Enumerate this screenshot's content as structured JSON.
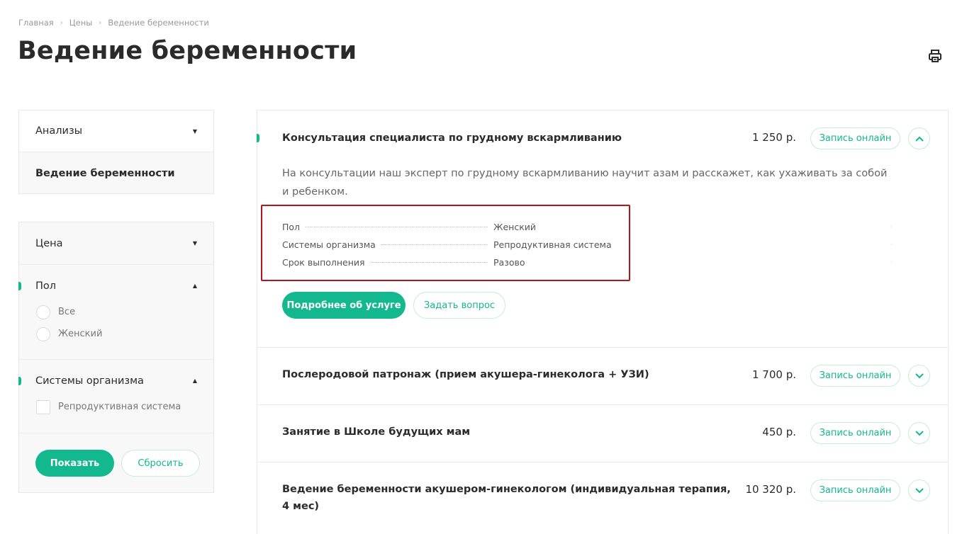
{
  "breadcrumb": {
    "items": [
      "Главная",
      "Цены",
      "Ведение беременности"
    ],
    "separator": "›"
  },
  "page": {
    "title": "Ведение беременности"
  },
  "icons": {
    "print": "printer-icon",
    "expand": "chevron-down-icon",
    "collapse": "chevron-up-icon"
  },
  "colors": {
    "accent": "#14b88e",
    "highlight": "#b4141b"
  },
  "sidebar": {
    "categories": [
      {
        "label": "Анализы",
        "state": "collapsed"
      },
      {
        "label": "Ведение беременности",
        "state": "selected"
      }
    ],
    "filters": {
      "price": {
        "label": "Цена",
        "state": "collapsed"
      },
      "gender": {
        "label": "Пол",
        "state": "expanded",
        "options": [
          "Все",
          "Женский"
        ]
      },
      "systems": {
        "label": "Системы организма",
        "state": "expanded",
        "options": [
          "Репродуктивная система"
        ]
      }
    },
    "show_label": "Показать",
    "reset_label": "Сбросить"
  },
  "services": [
    {
      "title": "Консультация специалиста по грудному вскармливанию",
      "price": "1 250 р.",
      "book_label": "Запись онлайн",
      "expanded": true,
      "description": "На консультации наш эксперт по грудному вскармливанию научит азам и расскажет, как ухаживать за собой и ребенком.",
      "attributes": [
        {
          "label": "Пол",
          "value": "Женский"
        },
        {
          "label": "Системы организма",
          "value": "Репродуктивная система"
        },
        {
          "label": "Срок выполнения",
          "value": "Разово"
        }
      ],
      "details_label": "Подробнее об услуге",
      "question_label": "Задать вопрос"
    },
    {
      "title": "Послеродовой патронаж (прием акушера-гинеколога + УЗИ)",
      "price": "1 700 р.",
      "book_label": "Запись онлайн",
      "expanded": false
    },
    {
      "title": "Занятие в Школе будущих мам",
      "price": "450 р.",
      "book_label": "Запись онлайн",
      "expanded": false
    },
    {
      "title": "Ведение беременности акушером-гинекологом (индивидуальная терапия, 4 мес)",
      "price": "10 320 р.",
      "book_label": "Запись онлайн",
      "expanded": false
    }
  ]
}
